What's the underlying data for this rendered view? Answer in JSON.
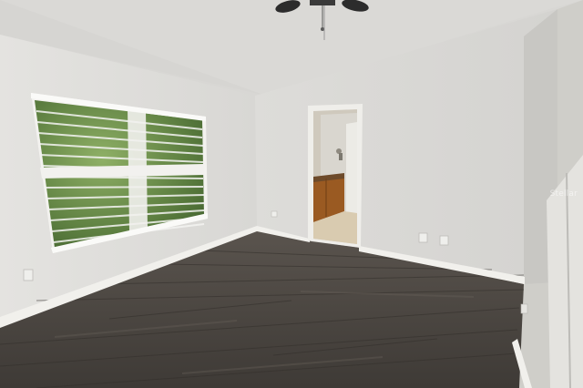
{
  "scene": {
    "description_tag": "empty-bedroom",
    "watermark": "Stellar",
    "colors": {
      "ceiling": "#d9d8d5",
      "left_wall": "#e2e1de",
      "back_wall": "#dcdbd8",
      "right_wall": "#cfcecb",
      "floor": "#4a4540",
      "baseboard": "#f2f1ee",
      "door_frame": "#efeeeb",
      "bath_floor": "#d9cbb0",
      "vanity": "#9a5a22",
      "fan": "#2c2c2c",
      "foliage": "#5e8040"
    }
  }
}
